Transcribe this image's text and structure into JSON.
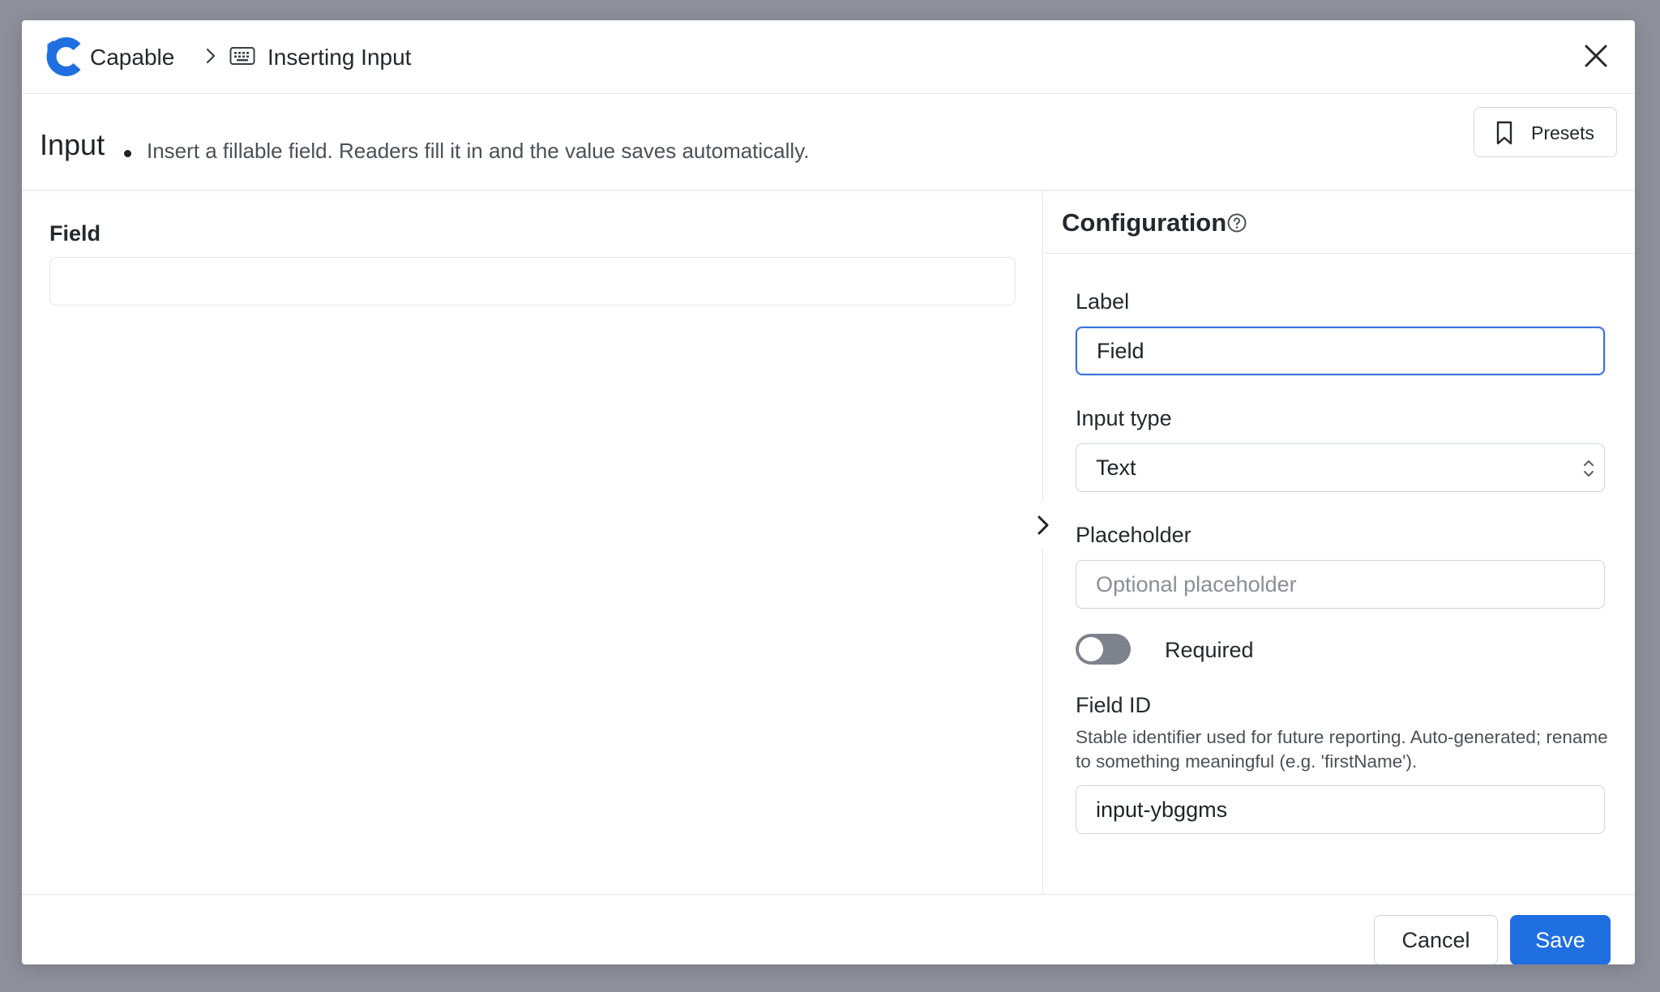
{
  "titlebar": {
    "brand": "Capable",
    "crumb_title": "Inserting Input"
  },
  "subheader": {
    "title": "Input",
    "description": "Insert a fillable field. Readers fill it in and the value saves automatically.",
    "presets_label": "Presets"
  },
  "preview": {
    "field_label": "Field",
    "field_value": ""
  },
  "config": {
    "title": "Configuration",
    "label_label": "Label",
    "label_value": "Field",
    "input_type_label": "Input type",
    "input_type_value": "Text",
    "placeholder_label": "Placeholder",
    "placeholder_placeholder": "Optional placeholder",
    "required_label": "Required",
    "required_on": false,
    "field_id_label": "Field ID",
    "field_id_help": "Stable identifier used for future reporting. Auto-generated; rename to something meaningful (e.g. 'firstName').",
    "field_id_value": "input-ybggms"
  },
  "footer": {
    "cancel_label": "Cancel",
    "save_label": "Save"
  },
  "colors": {
    "brand": "#1f6fe0",
    "focus_border": "#3b73d9",
    "backdrop": "#8d8f9a",
    "toggle_off": "#7d828b"
  },
  "icons": [
    "capable-logo-icon",
    "chevron-right-icon",
    "keyboard-icon",
    "close-icon",
    "bookmark-icon",
    "help-circle-icon",
    "select-chevrons-icon"
  ]
}
